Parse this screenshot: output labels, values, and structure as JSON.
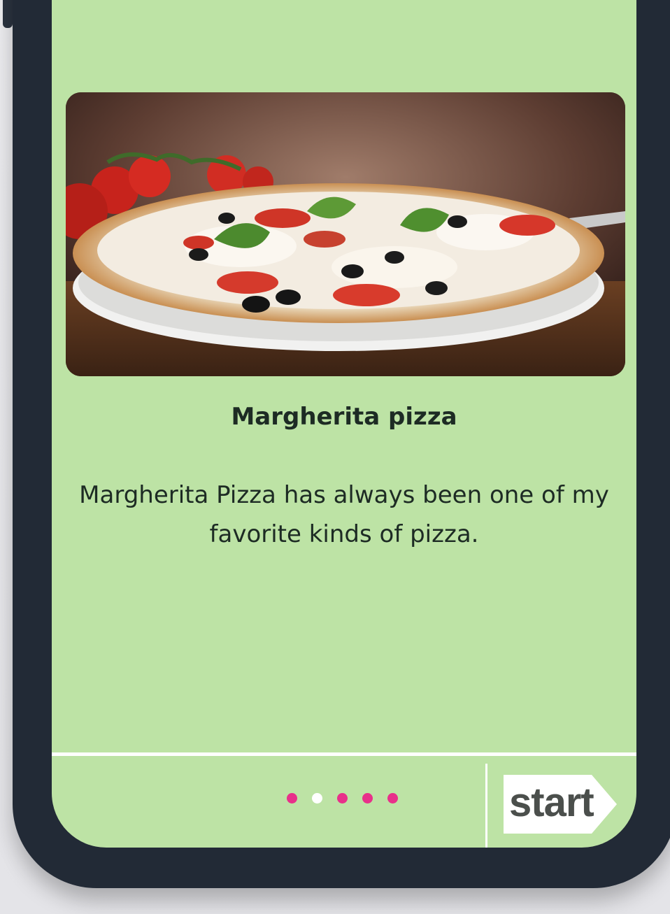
{
  "card": {
    "title": "Margherita pizza",
    "description": "Margherita Pizza has always been one of my favorite kinds of pizza."
  },
  "hero_image": {
    "subject": "pizza-photo"
  },
  "pager": {
    "total": 5,
    "active_index": 1
  },
  "footer": {
    "start_label": "start"
  },
  "colors": {
    "screen_bg": "#bde3a5",
    "dot": "#e8308a",
    "dot_active": "#ffffff",
    "frame": "#222a36",
    "text": "#1d2b24"
  }
}
